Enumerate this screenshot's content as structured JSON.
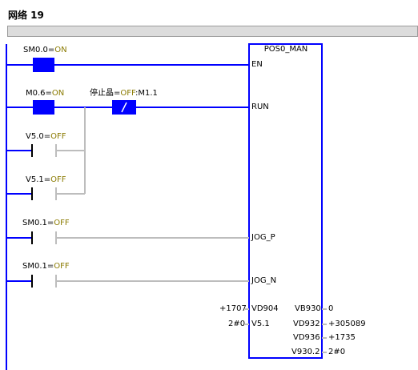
{
  "network": {
    "title": "网络 19"
  },
  "block": {
    "name": "POS0_MAN"
  },
  "contacts": [
    {
      "addr": "SM0.0",
      "state": "ON"
    },
    {
      "addr": "M0.6",
      "state": "ON"
    },
    {
      "name": "停止晶",
      "state": "OFF",
      "addr": "M1.1"
    },
    {
      "addr": "V5.0",
      "state": "OFF"
    },
    {
      "addr": "V5.1",
      "state": "OFF"
    },
    {
      "addr": "SM0.1",
      "state": "OFF"
    },
    {
      "addr": "SM0.1",
      "state": "OFF"
    }
  ],
  "inputs": [
    {
      "pin": "EN"
    },
    {
      "pin": "RUN"
    },
    {
      "pin": "JOG_P"
    },
    {
      "pin": "JOG_N"
    },
    {
      "pin": "VD904",
      "value": "+1707"
    },
    {
      "pin": "V5.1",
      "value": "2#0"
    }
  ],
  "outputs": [
    {
      "pin": "VB930",
      "value": "0"
    },
    {
      "pin": "VD932",
      "value": "+305089"
    },
    {
      "pin": "VD936",
      "value": "+1735"
    },
    {
      "pin": "V930.2",
      "value": "2#0"
    }
  ],
  "colors": {
    "power_flow": "#0000ff",
    "inactive": "#bdbdbd",
    "value": "#8a7a00",
    "block_border": "#0000ff"
  }
}
